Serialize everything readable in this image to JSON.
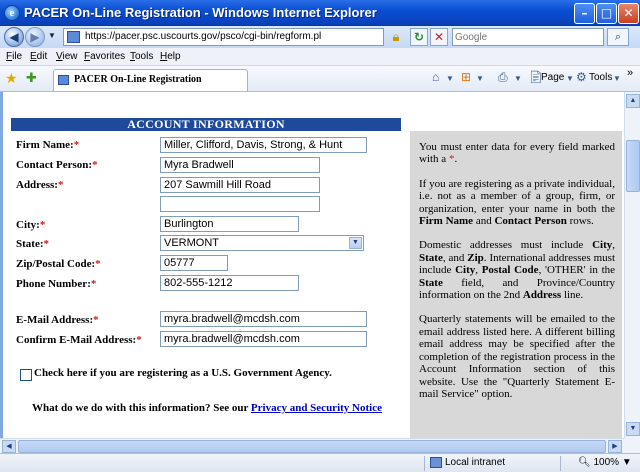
{
  "window": {
    "title": "PACER On-Line Registration - Windows Internet Explorer"
  },
  "address_bar": {
    "url": "https://pacer.psc.uscourts.gov/psco/cgi-bin/regform.pl",
    "search_placeholder": "Google"
  },
  "menu": [
    "File",
    "Edit",
    "View",
    "Favorites",
    "Tools",
    "Help"
  ],
  "tab": {
    "label": "PACER On-Line Registration"
  },
  "command_bar": {
    "page": "Page",
    "tools": "Tools"
  },
  "form": {
    "header": "ACCOUNT INFORMATION",
    "fields": {
      "firm_name": {
        "label": "Firm Name:",
        "value": "Miller, Clifford, Davis, Strong, & Hunt"
      },
      "contact_person": {
        "label": "Contact Person:",
        "value": "Myra Bradwell"
      },
      "address": {
        "label": "Address:",
        "value": "207 Sawmill Hill Road",
        "value2": ""
      },
      "city": {
        "label": "City:",
        "value": "Burlington"
      },
      "state": {
        "label": "State:",
        "value": "VERMONT"
      },
      "zip": {
        "label": "Zip/Postal Code:",
        "value": "05777"
      },
      "phone": {
        "label": "Phone Number:",
        "value": "802-555-1212"
      },
      "email": {
        "label": "E-Mail Address:",
        "value": "myra.bradwell@mcdsh.com"
      },
      "confirm_email": {
        "label": "Confirm E-Mail Address:",
        "value": "myra.bradwell@mcdsh.com"
      }
    },
    "required_marker": "*",
    "gov_checkbox_label": "Check here if you are registering as a U.S. Government Agency.",
    "info_question": "What do we do with this information? See our ",
    "privacy_link": "Privacy and Security Notice"
  },
  "side_panel": {
    "p1_a": "You must enter data for every field marked with a ",
    "p1_star": "*",
    "p1_b": ".",
    "p2_a": "If you are registering as a private individual, i.e. not as a member of a group, firm, or organization, enter your name in both the ",
    "p2_b1": "Firm Name",
    "p2_b": " and ",
    "p2_b2": "Contact Person",
    "p2_c": " rows.",
    "p3_a": "Domestic addresses must include ",
    "p3_b1": "City",
    "p3_b": ", ",
    "p3_b2": "State",
    "p3_c": ", and ",
    "p3_b3": "Zip",
    "p3_d": ". International addresses must include ",
    "p3_b4": "City",
    "p3_e": ", ",
    "p3_b5": "Postal Code",
    "p3_f": ", 'OTHER' in the ",
    "p3_b6": "State",
    "p3_g": " field, and Province/Country information on the 2nd ",
    "p3_b7": "Address",
    "p3_h": " line.",
    "p4": "Quarterly statements will be emailed to the email address listed here. A different billing email address may be specified after the completion of the registration process in the Account Information section of this website. Use the \"Quarterly Statement E-mail Service\" option."
  },
  "status_bar": {
    "zone": "Local intranet",
    "zoom": "100%"
  }
}
